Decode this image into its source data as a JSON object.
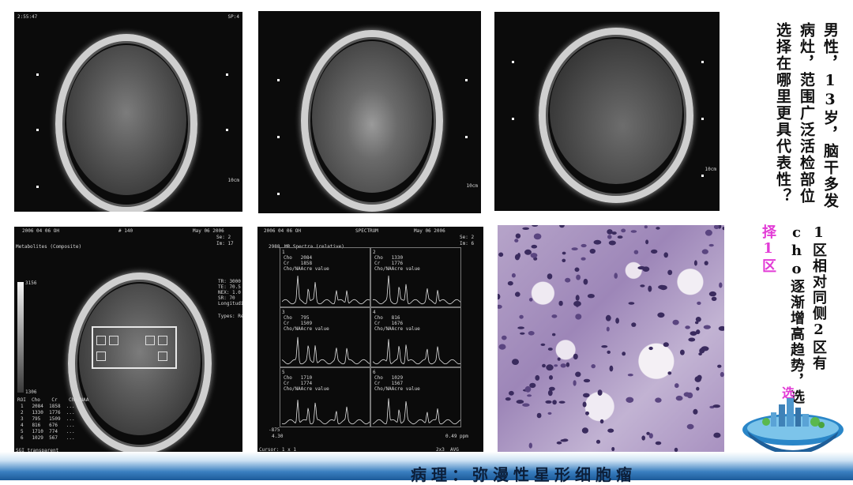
{
  "question_text": "男性，13岁，脑干多发病灶，范围广泛活检部位选择在哪里更具代表性？",
  "answer_main": "1区相对同侧2区有cho逐渐增高趋势，选",
  "answer_highlight": "择1区",
  "answer_accent_char": "选",
  "bottom_caption": "病理：弥漫性星形细胞瘤",
  "mri_top_left": {
    "corner_tl": "2:55:47",
    "corner_tr": "SP:4",
    "scale": "10cm"
  },
  "mri_top_mid": {
    "scale": "10cm"
  },
  "mri_top_right": {
    "scale": "10cm"
  },
  "mrs_map": {
    "header_l": "2006 04 06 OH",
    "header_mid": "# 140",
    "date": "May 06 2006",
    "se": "Se: 2",
    "im": "Im: 17",
    "title": "Metabolites (Composite)",
    "scale_top": "3156",
    "scale_bot": "1306",
    "params": "TR: 3000\nTE: 70.5\nNEX: 1.0\nSR: 70\nLongitudinal",
    "type": "Types: Re",
    "table_header": "ROI  Cho    Cr    Cho/NAA",
    "rows": [
      "1   2084  1858  ...",
      "2   1330  1776  ...",
      "3   795   1509  ...",
      "4   816   676   ...",
      "5   1710  774   ...",
      "6   1029  567   ..."
    ],
    "footer": "SGI transparent"
  },
  "mrs_spectrum": {
    "header_l": "2006 04 06 OH",
    "title": "SPECTRUM",
    "date": "May 06 2006",
    "se": "Se: 2",
    "im": "Im: 6",
    "yaxis_top": "2988",
    "yaxis_label": "MR Spectra (relative)",
    "yaxis_bot": "-875",
    "xaxis_l": "4.30",
    "xaxis_r": "0.49 ppm",
    "cursor": "Cursor: 1 x 1",
    "footer_r": "2x3  AVG",
    "cells": [
      {
        "num": "1",
        "cho": "Cho   2084",
        "cr": "Cr    1858",
        "ratio": "Cho/NAAcre value"
      },
      {
        "num": "2",
        "cho": "Cho   1330",
        "cr": "Cr    1776",
        "ratio": "Cho/NAAcre value"
      },
      {
        "num": "3",
        "cho": "Cho   795",
        "cr": "Cr    1509",
        "ratio": "Cho/NAAcre value"
      },
      {
        "num": "4",
        "cho": "Cho   816",
        "cr": "Cr    1676",
        "ratio": "Cho/NAAcre value"
      },
      {
        "num": "5",
        "cho": "Cho   1710",
        "cr": "Cr    1774",
        "ratio": "Cho/NAAcre value"
      },
      {
        "num": "6",
        "cho": "Cho   1029",
        "cr": "Cr    1567",
        "ratio": "Cho/NAAcre value"
      }
    ]
  }
}
